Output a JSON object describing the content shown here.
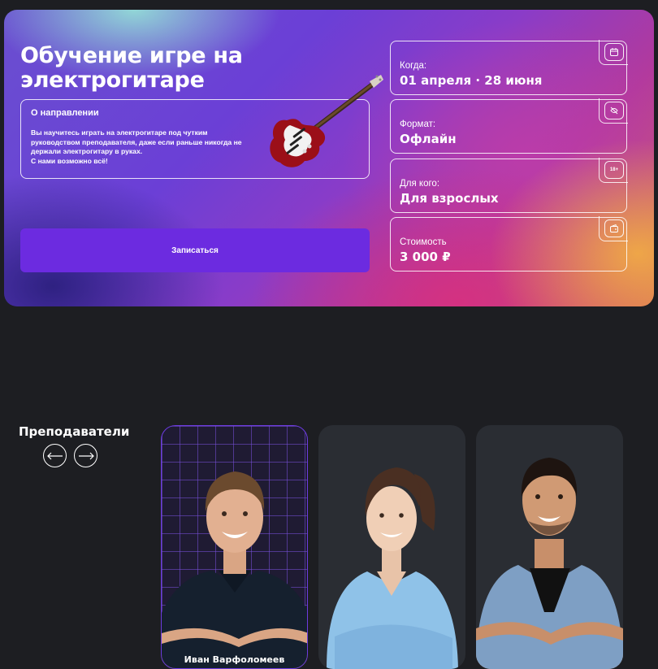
{
  "hero": {
    "title": "Обучение игре на электрогитаре",
    "about_title": "О направлении",
    "about_text": "Вы научитесь играть на электрогитаре под чутким руководством преподавателя, даже если раньше никогда не держали электрогитару в руках.\nС нами возможно всё!",
    "cta_label": "Записаться",
    "info": [
      {
        "label": "Когда:",
        "value": "01 апреля · 28 июня",
        "icon": "calendar-icon"
      },
      {
        "label": "Формат:",
        "value": "Офлайн",
        "icon": "no-stream-icon"
      },
      {
        "label": "Для кого:",
        "value": "Для взрослых",
        "icon": "age-18-icon"
      },
      {
        "label": "Стоимость",
        "value": "3 000 ₽",
        "icon": "wallet-icon"
      }
    ],
    "age_badge": "18+"
  },
  "teachers": {
    "title": "Преподаватели",
    "cards": [
      {
        "name": "Иван Варфоломеев"
      },
      {
        "name": ""
      },
      {
        "name": ""
      }
    ]
  },
  "colors": {
    "accent": "#6c2be0",
    "background": "#1d1e22",
    "card": "#2a2d33"
  }
}
